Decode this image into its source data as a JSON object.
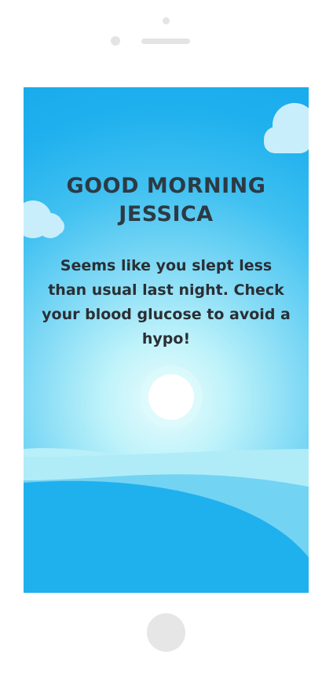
{
  "greeting": {
    "line1": "GOOD MORNING",
    "line2": "JESSICA"
  },
  "message": "Seems like you slept less than usual last night. Check your blood glucose to avoid a hypo!",
  "colors": {
    "sky_top": "#19abec",
    "sky_center": "#eafcfd",
    "hill_front": "#1fb0ee",
    "hill_mid": "#73d3f2",
    "hill_back": "#b0ecf7",
    "cloud": "#c9eefb",
    "text": "#2d3a44"
  }
}
